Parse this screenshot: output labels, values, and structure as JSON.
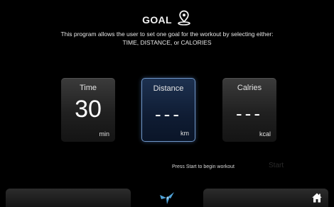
{
  "header": {
    "title": "GOAL",
    "icon": "map-pin-icon",
    "description": "This program allows the user to set one goal for the workout by selecting either: TIME, DISTANCE, or CALORIES"
  },
  "goals": {
    "time": {
      "label": "Time",
      "value": "30",
      "unit": "min"
    },
    "distance": {
      "label": "Distance",
      "value": "---",
      "unit": "km",
      "selected": true
    },
    "calories": {
      "label": "Calries",
      "value": "---",
      "unit": "kcal"
    }
  },
  "footer": {
    "prompt": "Press Start to begin workout",
    "start_label": "Start",
    "logo_icon": "brand-logo-icon",
    "home_icon": "home-icon"
  },
  "colors": {
    "background": "#000000",
    "selected_border": "#6f96c8",
    "selected_fill": "#1d3150",
    "start_disabled": "#2a2a2a"
  }
}
